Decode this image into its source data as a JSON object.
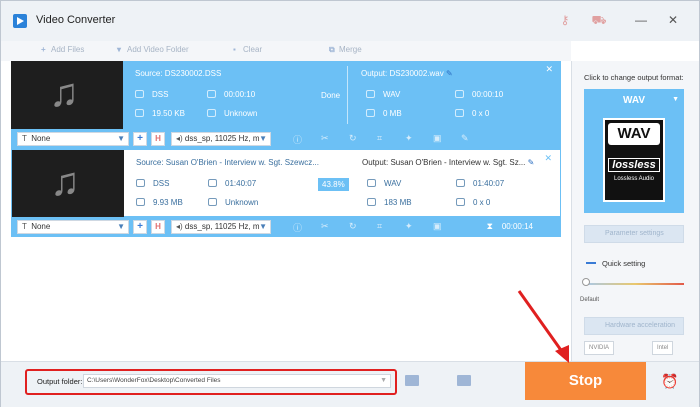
{
  "titlebar": {
    "app_title": "Video Converter",
    "icons": [
      "key-icon",
      "cart-icon",
      "minimize-icon",
      "close-icon"
    ]
  },
  "toolbar": {
    "add_files": "Add Files",
    "add_video_folder": "Add Video Folder",
    "clear": "Clear",
    "merge": "Merge"
  },
  "tasks": [
    {
      "source_title": "Source: DS230002.DSS",
      "src_format": "DSS",
      "src_duration": "00:00:10",
      "src_size": "19.50 KB",
      "src_resolution": "Unknown",
      "status": "Done",
      "output_title": "Output: DS230002.wav",
      "out_format": "WAV",
      "out_duration": "00:00:10",
      "out_size": "0 MB",
      "out_resolution": "0 x 0",
      "subtitle": "None",
      "audio": "dss_sp, 11025 Hz, m"
    },
    {
      "source_title": "Source: Susan O'Brien - Interview w. Sgt. Szewcz...",
      "src_format": "DSS",
      "src_duration": "01:40:07",
      "src_size": "9.93 MB",
      "src_resolution": "Unknown",
      "status": "43.8%",
      "output_title": "Output: Susan O'Brien - Interview w. Sgt. Sz...",
      "out_format": "WAV",
      "out_duration": "01:40:07",
      "out_size": "183 MB",
      "out_resolution": "0 x 0",
      "subtitle": "None",
      "audio": "dss_sp, 11025 Hz, m",
      "elapsed": "00:00:14"
    }
  ],
  "panel": {
    "hint": "Click to change output format:",
    "format": "WAV",
    "card_label": "WAV",
    "card_lossless": "lossless",
    "card_sub": "Lossless Audio",
    "parameter_settings": "Parameter settings",
    "quick_setting": "Quick setting",
    "slider_default": "Default",
    "hw_accel": "Hardware acceleration",
    "chip_nvidia": "NVIDIA",
    "chip_intel": "Intel"
  },
  "bottom": {
    "output_folder_label": "Output folder:",
    "output_folder_path": "C:\\Users\\WonderFox\\Desktop\\Converted Files",
    "stop_label": "Stop"
  },
  "colors": {
    "accent": "#6cc0f5",
    "stop": "#f7893a",
    "highlight": "#e02020"
  }
}
